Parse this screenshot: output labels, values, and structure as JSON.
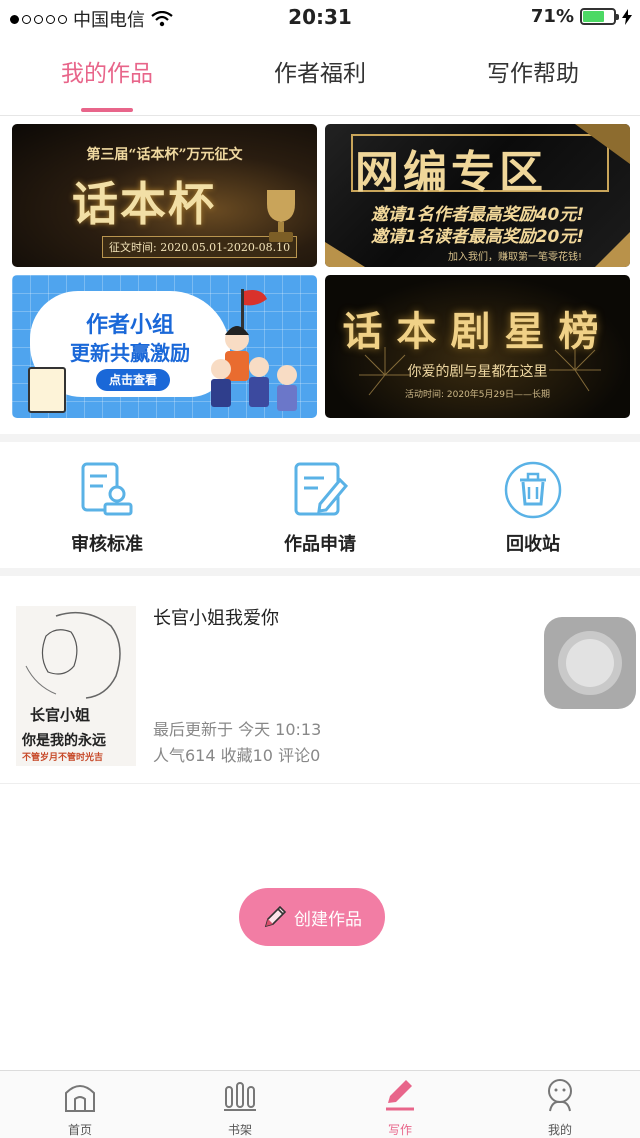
{
  "status_bar": {
    "carrier": "中国电信",
    "time": "20:31",
    "battery_pct": "71%",
    "battery_level": 0.71,
    "signal_dots_filled": 1,
    "signal_dots_total": 5,
    "icons": [
      "wifi-icon",
      "battery-icon",
      "charging-icon"
    ]
  },
  "tabs": [
    {
      "label": "我的作品",
      "active": true
    },
    {
      "label": "作者福利",
      "active": false
    },
    {
      "label": "写作帮助",
      "active": false
    }
  ],
  "banners": {
    "b1": {
      "sub": "第三届“话本杯”万元征文",
      "big": "话本杯",
      "date": "征文时间: 2020.05.01-2020-08.10"
    },
    "b2": {
      "big": "网编专区",
      "line1": "邀请1名作者最高奖励40元!",
      "line2": "邀请1名读者最高奖励20元!",
      "foot": "加入我们，赚取第一笔零花钱!"
    },
    "b3": {
      "line1": "作者小组",
      "line2": "更新共赢激励",
      "button": "点击查看"
    },
    "b4": {
      "big": "话本剧星榜",
      "sub": "你爱的剧与星都在这里",
      "foot": "活动时间: 2020年5月29日——长期"
    }
  },
  "features": [
    {
      "label": "审核标准",
      "icon": "review-standard-icon"
    },
    {
      "label": "作品申请",
      "icon": "work-apply-icon"
    },
    {
      "label": "回收站",
      "icon": "trash-icon"
    }
  ],
  "work": {
    "title": "长官小姐我爱你",
    "updated": "最后更新于 今天 10:13",
    "stats": "人气614  收藏10  评论0",
    "cover": {
      "line1": "长官小姐",
      "line2": "你是我的永远",
      "line3": "不管岁月不管时光吉"
    }
  },
  "create_button": "创建作品",
  "bottom_nav": [
    {
      "label": "首页",
      "icon": "home-icon",
      "active": false
    },
    {
      "label": "书架",
      "icon": "bookshelf-icon",
      "active": false
    },
    {
      "label": "写作",
      "icon": "write-icon",
      "active": true
    },
    {
      "label": "我的",
      "icon": "profile-icon",
      "active": false
    }
  ],
  "colors": {
    "accent": "#e8658a",
    "create_button": "#f27da4",
    "feature_icon": "#5ab2e6"
  }
}
